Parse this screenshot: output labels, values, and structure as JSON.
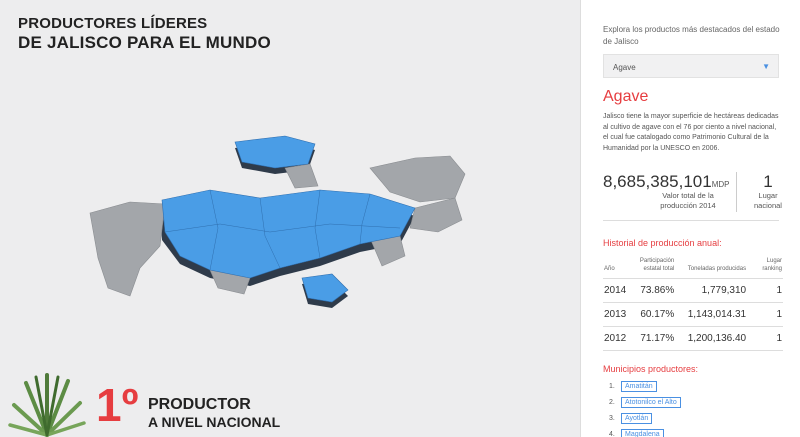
{
  "header": {
    "title_line1": "PRODUCTORES LÍDERES",
    "title_line2": "DE JALISCO PARA EL MUNDO"
  },
  "rank_badge": {
    "number": "1º",
    "line1": "PRODUCTOR",
    "line2": "A NIVEL NACIONAL"
  },
  "map": {
    "highlight_color": "#4a9de6",
    "base_color": "#a3a6aa",
    "shadow_color": "#2f3b4a"
  },
  "sidebar": {
    "intro": "Explora los productos más destacados del estado de Jalisco",
    "select": {
      "value": "Agave",
      "arrow_icon": "caret-down-icon"
    },
    "product_title": "Agave",
    "description": "Jalisco tiene la mayor superficie de hectáreas dedicadas al cultivo de agave con el 76 por ciento a nivel nacional, el cual fue catalogado como Patrimonio Cultural de la Humanidad por la UNESCO en 2006.",
    "value": "8,685,385,101",
    "value_unit": "MDP",
    "value_label": "Valor total de la producción 2014",
    "rank": "1",
    "rank_label": "Lugar nacional",
    "history_title": "Historial de producción anual:",
    "history_headers": [
      "Año",
      "Participación estatal total",
      "Toneladas producidas",
      "Lugar ranking"
    ],
    "history_rows": [
      [
        "2014",
        "73.86%",
        "1,779,310",
        "1"
      ],
      [
        "2013",
        "60.17%",
        "1,143,014.31",
        "1"
      ],
      [
        "2012",
        "71.17%",
        "1,200,136.40",
        "1"
      ]
    ],
    "municipios_title": "Municipios productores:",
    "municipios": [
      {
        "num": "1.",
        "name": "Amatitán"
      },
      {
        "num": "2.",
        "name": "Atotonilco el Alto"
      },
      {
        "num": "3.",
        "name": "Ayotlán"
      },
      {
        "num": "4.",
        "name": "Magdalena"
      }
    ]
  },
  "colors": {
    "accent_red": "#e63d40",
    "link_blue": "#4a90e2"
  }
}
